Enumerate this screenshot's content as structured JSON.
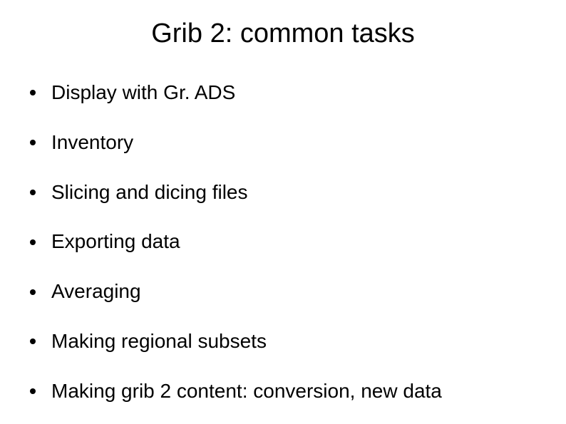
{
  "slide": {
    "title": "Grib 2: common tasks",
    "bullets": [
      "Display with Gr. ADS",
      "Inventory",
      "Slicing and dicing files",
      "Exporting data",
      "Averaging",
      "Making regional subsets",
      "Making grib 2 content: conversion, new data"
    ]
  }
}
